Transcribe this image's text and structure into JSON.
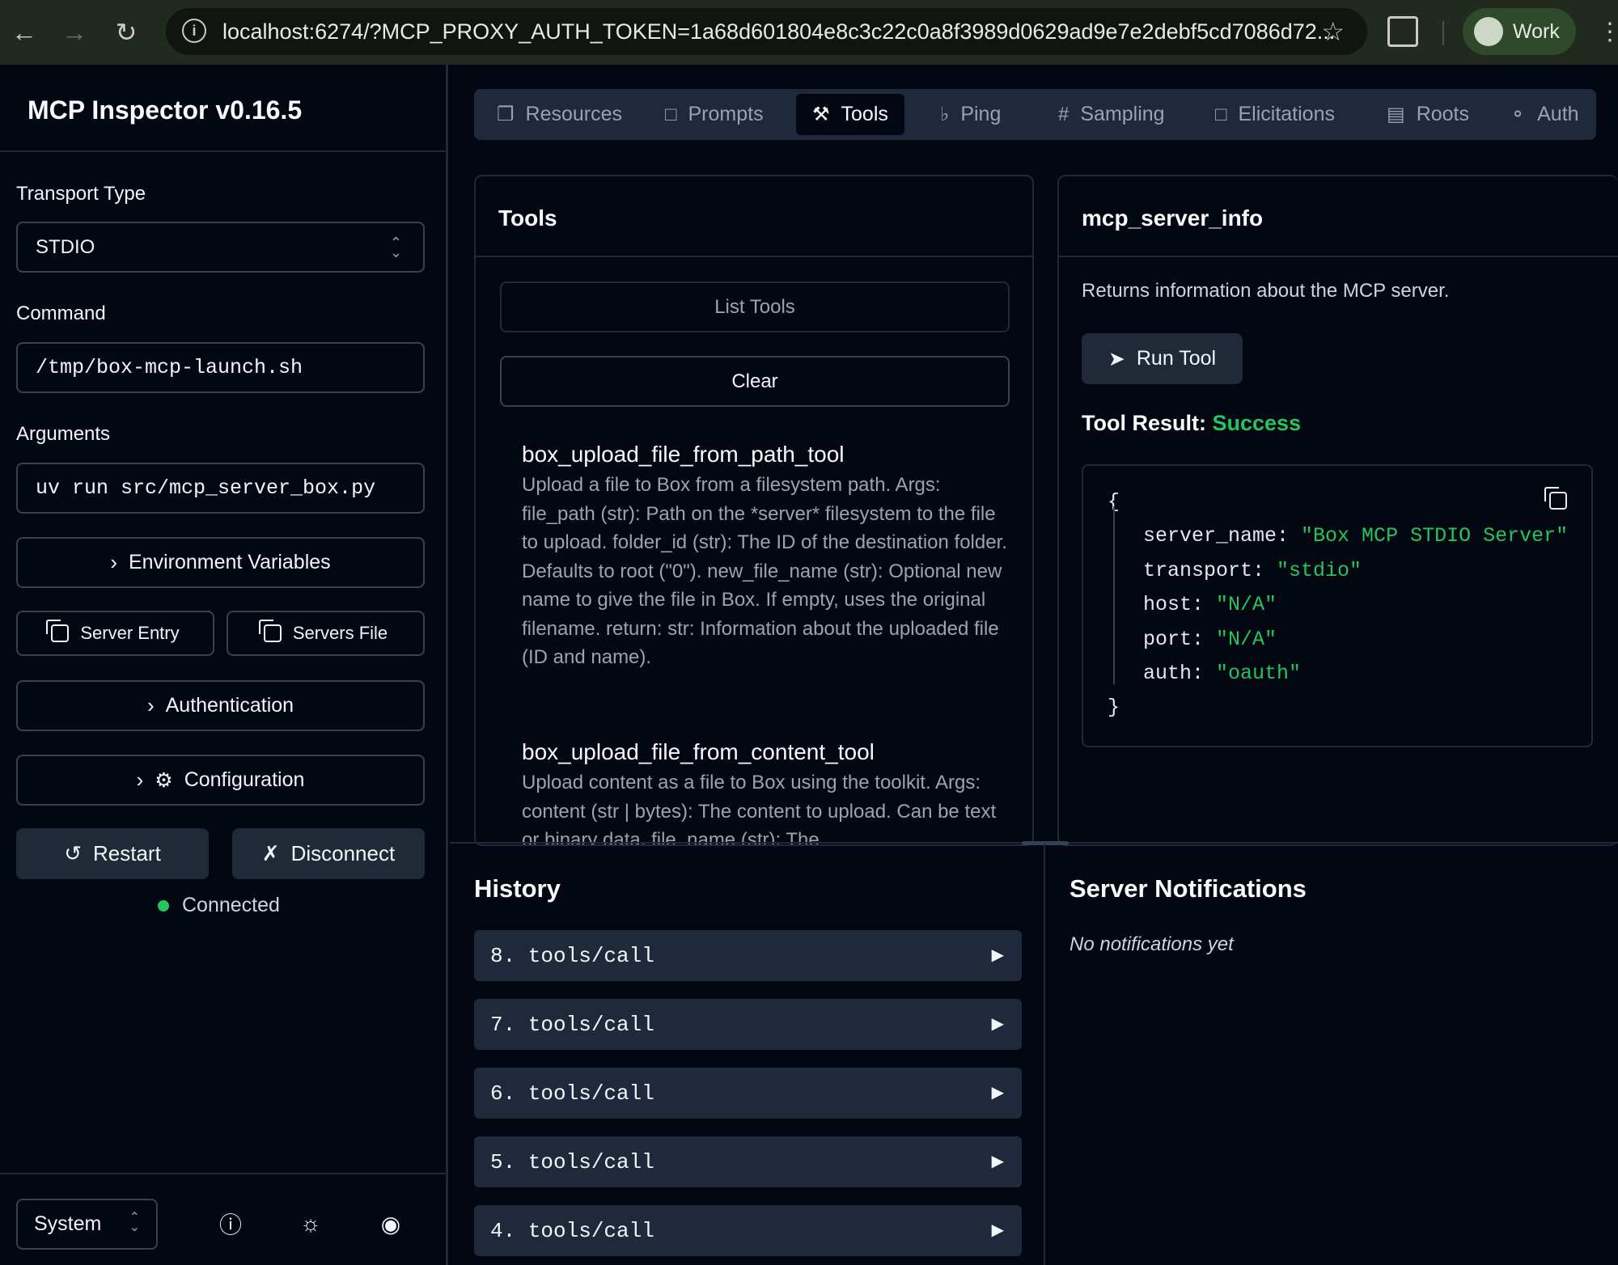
{
  "browser": {
    "url": "localhost:6274/?MCP_PROXY_AUTH_TOKEN=1a68d601804e8c3c22c0a8f3989d0629ad9e7e2debf5cd7086d72...",
    "profile_label": "Work"
  },
  "sidebar": {
    "title": "MCP Inspector v0.16.5",
    "transport_label": "Transport Type",
    "transport_value": "STDIO",
    "command_label": "Command",
    "command_value": "/tmp/box-mcp-launch.sh",
    "arguments_label": "Arguments",
    "arguments_value": "uv run src/mcp_server_box.py",
    "env_vars_label": "Environment Variables",
    "server_entry_label": "Server Entry",
    "servers_file_label": "Servers File",
    "authentication_label": "Authentication",
    "configuration_label": "Configuration",
    "restart_label": "Restart",
    "disconnect_label": "Disconnect",
    "status_text": "Connected",
    "theme_value": "System"
  },
  "tabs": [
    {
      "label": "Resources",
      "icon": "file-copy-icon"
    },
    {
      "label": "Prompts",
      "icon": "message-icon"
    },
    {
      "label": "Tools",
      "icon": "hammer-icon"
    },
    {
      "label": "Ping",
      "icon": "bell-icon"
    },
    {
      "label": "Sampling",
      "icon": "hash-icon"
    },
    {
      "label": "Elicitations",
      "icon": "message-square-icon"
    },
    {
      "label": "Roots",
      "icon": "folder-tree-icon"
    },
    {
      "label": "Auth",
      "icon": "key-icon"
    }
  ],
  "active_tab": "Tools",
  "tools_panel": {
    "title": "Tools",
    "list_button": "List Tools",
    "clear_button": "Clear",
    "tools": [
      {
        "name": "box_upload_file_from_path_tool",
        "description": "Upload a file to Box from a filesystem path. Args: file_path (str): Path on the *server* filesystem to the file to upload. folder_id (str): The ID of the destination folder. Defaults to root (\"0\"). new_file_name (str): Optional new name to give the file in Box. If empty, uses the original filename. return: str: Information about the uploaded file (ID and name)."
      },
      {
        "name": "box_upload_file_from_content_tool",
        "description": "Upload content as a file to Box using the toolkit. Args: content (str | bytes): The content to upload. Can be text or binary data. file_name (str): The"
      }
    ]
  },
  "detail_panel": {
    "title": "mcp_server_info",
    "description": "Returns information about the MCP server.",
    "run_button": "Run Tool",
    "result_label": "Tool Result:",
    "result_status": "Success",
    "json_open": "{",
    "json_close": "}",
    "json_rows": [
      {
        "key": "server_name:",
        "value": "\"Box MCP STDIO Server\""
      },
      {
        "key": "transport:",
        "value": "\"stdio\""
      },
      {
        "key": "host:",
        "value": "\"N/A\""
      },
      {
        "key": "port:",
        "value": "\"N/A\""
      },
      {
        "key": "auth:",
        "value": "\"oauth\""
      }
    ]
  },
  "history": {
    "title": "History",
    "items": [
      "8. tools/call",
      "7. tools/call",
      "6. tools/call",
      "5. tools/call",
      "4. tools/call"
    ]
  },
  "notifications": {
    "title": "Server Notifications",
    "empty_text": "No notifications yet"
  },
  "colors": {
    "background": "#030712",
    "accent_success": "#22c55e",
    "tab_bar": "#1e293b",
    "browser_chrome": "#22291f"
  }
}
